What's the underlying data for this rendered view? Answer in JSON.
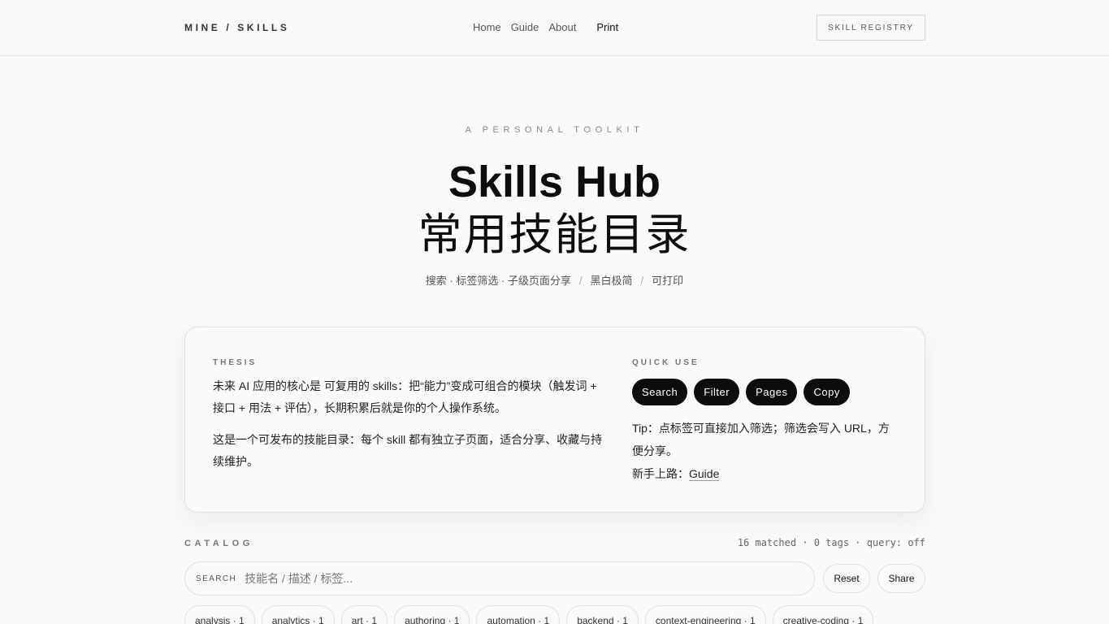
{
  "header": {
    "brand": "MINE / SKILLS",
    "nav": [
      "Home",
      "Guide",
      "About"
    ],
    "print": "Print",
    "registry": "SKILL REGISTRY"
  },
  "hero": {
    "eyebrow": "A PERSONAL TOOLKIT",
    "title_en": "Skills Hub",
    "title_zh": "常用技能目录",
    "subtitle_parts": [
      "搜索 · 标签筛选 · 子级页面分享",
      "黑白极简",
      "可打印"
    ],
    "subtitle_sep": "/"
  },
  "card": {
    "thesis_label": "THESIS",
    "thesis_p1": "未来 AI 应用的核心是 可复用的 skills：把“能力”变成可组合的模块（触发词 + 接口 + 用法 + 评估），长期积累后就是你的个人操作系统。",
    "thesis_p2": "这是一个可发布的技能目录：每个 skill 都有独立子页面，适合分享、收藏与持续维护。",
    "quick_label": "QUICK USE",
    "pills": [
      "Search",
      "Filter",
      "Pages",
      "Copy"
    ],
    "tip": "Tip：点标签可直接加入筛选；筛选会写入 URL，方便分享。",
    "guide_prefix": "新手上路：",
    "guide_link": "Guide"
  },
  "catalog": {
    "label": "CATALOG",
    "meta": "16 matched · 0 tags · query: off",
    "search_label": "SEARCH",
    "search_placeholder": "技能名 / 描述 / 标签...",
    "search_value": "",
    "reset": "Reset",
    "share": "Share",
    "tags": [
      "analysis · 1",
      "analytics · 1",
      "art · 1",
      "authoring · 1",
      "automation · 1",
      "backend · 1",
      "context-engineering · 1",
      "creative-coding · 1"
    ]
  }
}
